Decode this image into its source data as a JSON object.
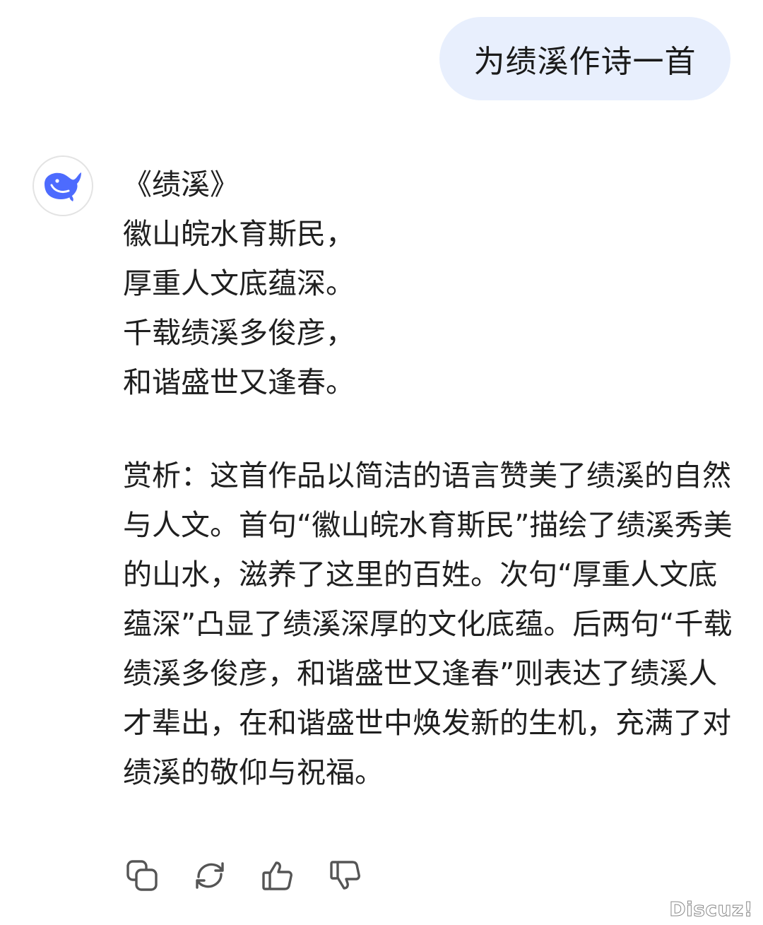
{
  "user_message": {
    "text": "为绩溪作诗一首"
  },
  "assistant": {
    "avatar_icon": "deepseek-whale-icon",
    "avatar_color": "#4d6bfe",
    "poem": {
      "title": "《绩溪》",
      "lines": [
        "徽山皖水育斯民，",
        "厚重人文底蕴深。",
        "千载绩溪多俊彦，",
        "和谐盛世又逢春。"
      ]
    },
    "analysis": "赏析：这首作品以简洁的语言赞美了绩溪的自然与人文。首句“徽山皖水育斯民”描绘了绩溪秀美的山水，滋养了这里的百姓。次句“厚重人文底蕴深”凸显了绩溪深厚的文化底蕴。后两句“千载绩溪多俊彦，和谐盛世又逢春”则表达了绩溪人才辈出，在和谐盛世中焕发新的生机，充满了对绩溪的敬仰与祝福。"
  },
  "actions": [
    {
      "name": "copy-icon"
    },
    {
      "name": "regenerate-icon"
    },
    {
      "name": "thumbs-up-icon"
    },
    {
      "name": "thumbs-down-icon"
    }
  ],
  "watermark": "Discuz!"
}
